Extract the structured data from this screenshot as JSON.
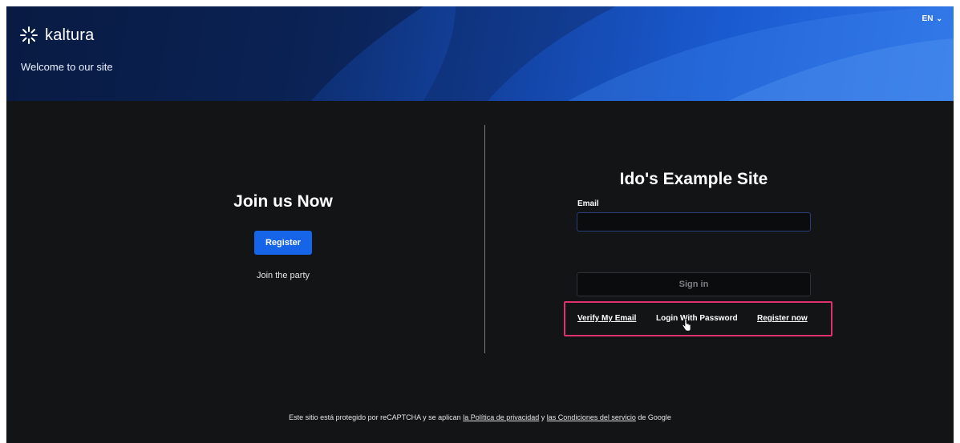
{
  "header": {
    "logo_text": "kaltura",
    "welcome": "Welcome to our site",
    "language": "EN",
    "language_icon": "chevron-down-icon",
    "colors": {
      "brand_blue": "#1664e8",
      "header_dark": "#0a1d47"
    }
  },
  "join": {
    "title": "Join us Now",
    "register_label": "Register",
    "subtitle": "Join the party"
  },
  "login": {
    "site_title": "Ido's Example Site",
    "email_label": "Email",
    "email_value": "",
    "signin_label": "Sign in",
    "links": {
      "verify": "Verify My Email",
      "login_password": "Login With Password",
      "register_now": "Register now"
    },
    "highlight_color": "#e0306e"
  },
  "footer": {
    "prefix": "Este sitio está protegido por reCAPTCHA y se aplican",
    "privacy_link": "la Política de privacidad",
    "and": "y",
    "terms_link": "las Condiciones del servicio",
    "suffix": "de Google"
  }
}
